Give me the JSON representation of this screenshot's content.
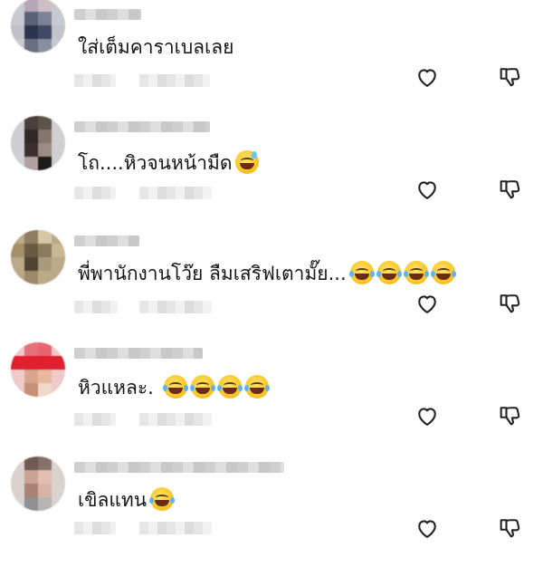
{
  "comments": [
    {
      "text": "ใส่เต็มคาราเบลเลย",
      "emojis": [],
      "emoji_kind": ""
    },
    {
      "text": "โถ....หิวจนหน้ามืด",
      "emojis": [
        "sweat-smile"
      ],
      "emoji_kind": "sweat-smile"
    },
    {
      "text": "พี่พานักงานโว๊ย ลืมเสริฟเตามั๊ย...",
      "emojis": [
        "joy",
        "joy",
        "joy",
        "joy"
      ],
      "emoji_kind": "joy"
    },
    {
      "text": "หิวแหละ.",
      "emojis": [
        "joy",
        "joy",
        "joy",
        "joy"
      ],
      "emoji_kind": "joy"
    },
    {
      "text": "เขิลแทน",
      "emojis": [
        "joy"
      ],
      "emoji_kind": "joy"
    }
  ],
  "icons": {
    "like": "heart-icon",
    "dislike": "thumbs-down-icon"
  },
  "colors": {
    "background": "#ffffff",
    "text": "#141414",
    "icon": "#222222"
  }
}
